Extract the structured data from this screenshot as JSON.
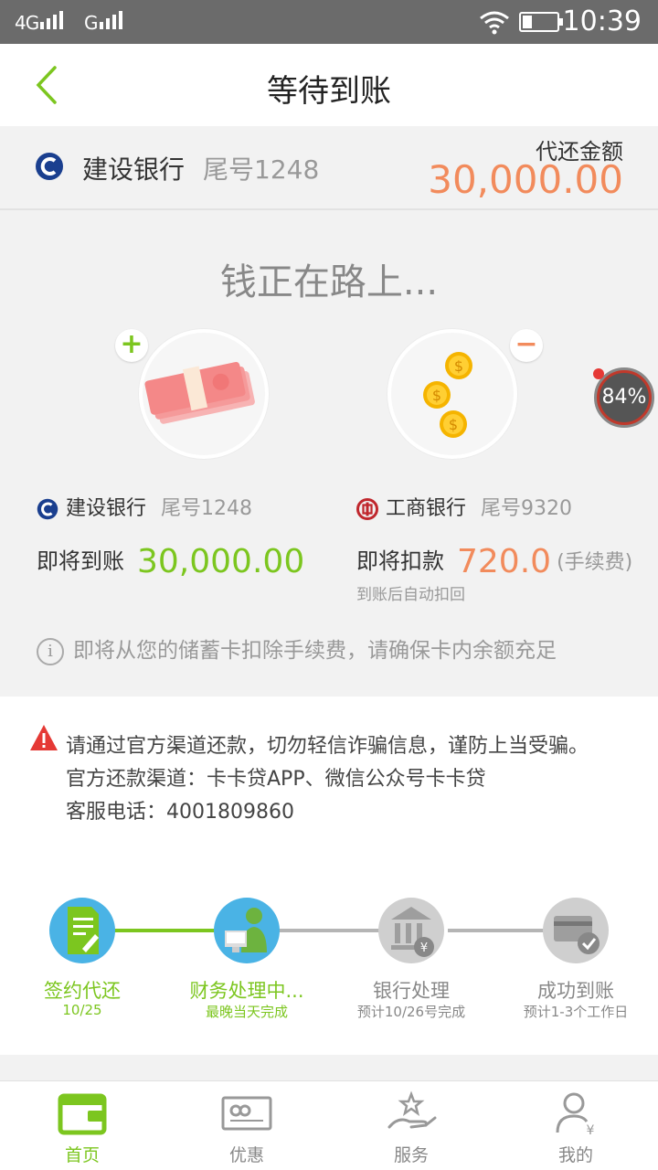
{
  "status_bar": {
    "signal1": "4G",
    "signal2": "G",
    "time": "10:39"
  },
  "nav": {
    "title": "等待到账"
  },
  "bank_header": {
    "bank_name": "建设银行",
    "tail": "尾号1248",
    "amount_label": "代还金额",
    "amount": "30,000.00"
  },
  "flow": {
    "headline": "钱正在路上...",
    "progress_badge": "84%",
    "incoming": {
      "bank": "建设银行",
      "tail": "尾号1248",
      "label": "即将到账",
      "amount": "30,000.00"
    },
    "outgoing": {
      "bank": "工商银行",
      "tail": "尾号9320",
      "label": "即将扣款",
      "amount": "720.0",
      "note": "(手续费)",
      "subnote": "到账后自动扣回"
    },
    "info": "即将从您的储蓄卡扣除手续费，请确保卡内余额充足"
  },
  "warning": {
    "line1": "请通过官方渠道还款，切勿轻信诈骗信息，谨防上当受骗。",
    "line2": "官方还款渠道：卡卡贷APP、微信公众号卡卡贷",
    "line3": "客服电话：4001809860"
  },
  "steps": [
    {
      "label": "签约代还",
      "sub": "10/25",
      "state": "done"
    },
    {
      "label": "财务处理中...",
      "sub": "最晚当天完成",
      "state": "active"
    },
    {
      "label": "银行处理",
      "sub": "预计10/26号完成",
      "state": "pending"
    },
    {
      "label": "成功到账",
      "sub": "预计1-3个工作日",
      "state": "pending"
    }
  ],
  "tabs": [
    {
      "label": "首页",
      "icon": "wallet-icon",
      "active": true
    },
    {
      "label": "优惠",
      "icon": "coupon-icon",
      "active": false
    },
    {
      "label": "服务",
      "icon": "service-hand-icon",
      "active": false
    },
    {
      "label": "我的",
      "icon": "user-icon",
      "active": false
    }
  ],
  "colors": {
    "accent_green": "#7cc61f",
    "accent_orange": "#f28b5c",
    "ccb_blue": "#1a3f8f",
    "icbc_red": "#c0272d"
  }
}
